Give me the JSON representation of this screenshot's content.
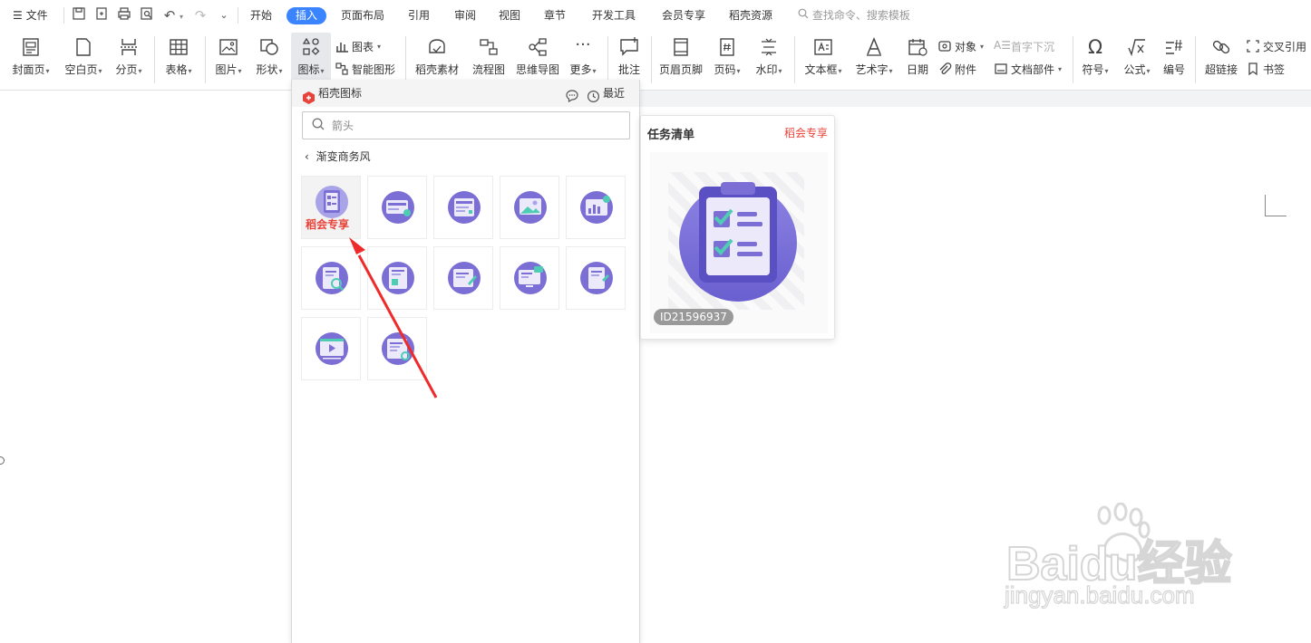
{
  "menubar": {
    "file": "文件",
    "tabs": [
      {
        "label": "开始"
      },
      {
        "label": "插入"
      },
      {
        "label": "页面布局"
      },
      {
        "label": "引用"
      },
      {
        "label": "审阅"
      },
      {
        "label": "视图"
      },
      {
        "label": "章节"
      },
      {
        "label": "开发工具"
      },
      {
        "label": "会员专享"
      },
      {
        "label": "稻壳资源"
      }
    ],
    "search_placeholder": "查找命令、搜索模板"
  },
  "ribbon": {
    "cover": "封面页",
    "blank": "空白页",
    "page_break": "分页",
    "table": "表格",
    "picture": "图片",
    "shape": "形状",
    "icons": "图标",
    "chart": "图表",
    "smart_shape": "智能图形",
    "docer_material": "稻壳素材",
    "flowchart": "流程图",
    "mindmap": "思维导图",
    "more": "更多",
    "comment": "批注",
    "header_footer": "页眉页脚",
    "page_number": "页码",
    "watermark": "水印",
    "textbox": "文本框",
    "wordart": "艺术字",
    "date": "日期",
    "object": "对象",
    "attachment": "附件",
    "drop_cap": "首字下沉",
    "doc_parts": "文档部件",
    "symbol": "符号",
    "formula": "公式",
    "numbering": "编号",
    "hyperlink": "超链接",
    "cross_ref": "交叉引用",
    "bookmark": "书签"
  },
  "panel": {
    "title": "稻壳图标",
    "recent": "最近",
    "search_value": "箭头",
    "back_label": "渐变商务风",
    "member_badge": "稻会专享"
  },
  "preview": {
    "title": "任务清单",
    "vip": "稻会专享",
    "id": "ID21596937"
  },
  "watermark": {
    "brand": "Baidu经验",
    "url": "jingyan.baidu.com"
  },
  "colors": {
    "accent": "#3a84ff",
    "vip_red": "#e8433a",
    "icon_purple": "#7b6fd6",
    "icon_teal": "#4ecdb4"
  }
}
